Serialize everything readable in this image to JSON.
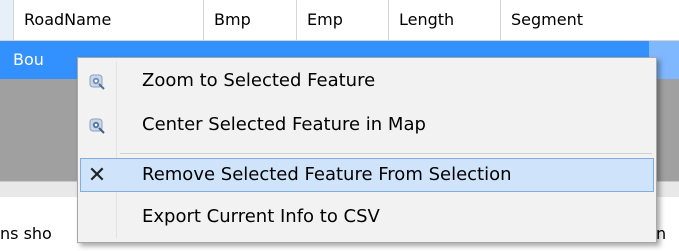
{
  "grid": {
    "columns": [
      {
        "label": "RoadName"
      },
      {
        "label": "Bmp"
      },
      {
        "label": "Emp"
      },
      {
        "label": "Length"
      },
      {
        "label": "Segment"
      }
    ],
    "selected_row": {
      "first_cell": "Bou"
    }
  },
  "status_bar": {
    "left_fragment": "ns sho",
    "right_fragment": "n"
  },
  "context_menu": {
    "items": [
      {
        "label": "Zoom to Selected Feature",
        "icon": "zoom-feature-icon"
      },
      {
        "label": "Center Selected Feature in Map",
        "icon": "center-feature-icon"
      },
      {
        "label": "Remove Selected Feature From Selection",
        "icon": "remove-x-icon",
        "highlighted": true
      },
      {
        "label": "Export Current Info to CSV",
        "icon": ""
      }
    ]
  },
  "colors": {
    "selection_row": "#3390ff",
    "menu_highlight": "#cfe4fa",
    "menu_highlight_border": "#84acdd"
  }
}
